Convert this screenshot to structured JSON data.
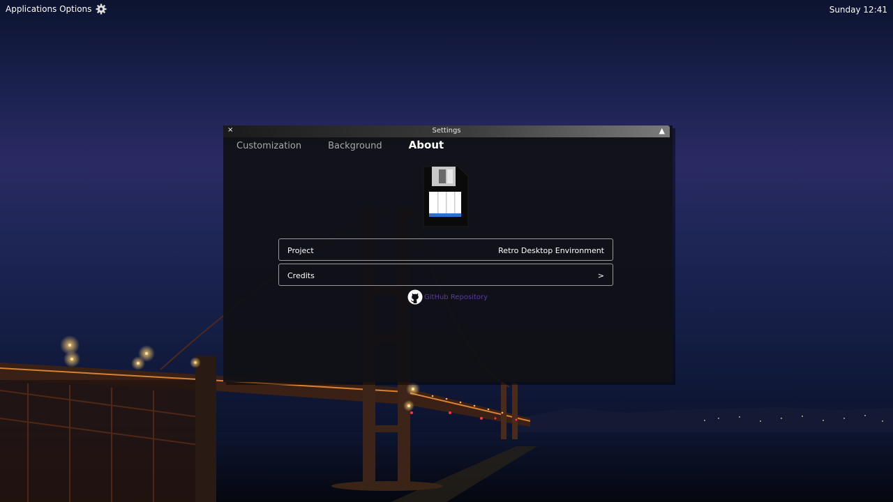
{
  "topbar": {
    "menu_label": "Applications Options",
    "menu_icon": "gear-icon",
    "clock": "Sunday 12:41"
  },
  "window": {
    "title": "Settings",
    "close_glyph": "×",
    "collapse_glyph": "▲",
    "tabs": [
      {
        "label": "Customization",
        "active": false
      },
      {
        "label": "Background",
        "active": false
      },
      {
        "label": "About",
        "active": true
      }
    ],
    "logo_icon": "floppy-disk-icon",
    "rows": {
      "project": {
        "label": "Project",
        "value": "Retro Desktop Environment"
      },
      "credits": {
        "label": "Credits",
        "chevron": ">"
      }
    },
    "github": {
      "icon": "github-icon",
      "label": "GitHub Repository"
    }
  },
  "colors": {
    "link": "#5a3a9e",
    "window_bg": "#101014",
    "row_border": "#9a9a9a"
  }
}
